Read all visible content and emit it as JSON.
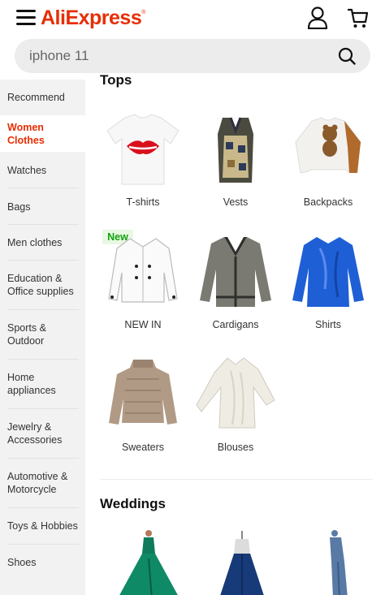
{
  "header": {
    "logo": "AliExpress",
    "logo_mark": "®",
    "icons": [
      "menu-icon",
      "user-icon",
      "cart-icon"
    ]
  },
  "search": {
    "value": "iphone 11",
    "icon": "search-icon"
  },
  "sidebar": {
    "items": [
      {
        "label": "Recommend",
        "active": false
      },
      {
        "label": "Women Clothes",
        "active": true
      },
      {
        "label": "Watches",
        "active": false
      },
      {
        "label": "Bags",
        "active": false
      },
      {
        "label": "Men clothes",
        "active": false
      },
      {
        "label": "Education & Office supplies",
        "active": false
      },
      {
        "label": "Sports & Outdoor",
        "active": false
      },
      {
        "label": "Home appliances",
        "active": false
      },
      {
        "label": "Jewelry & Accessories",
        "active": false
      },
      {
        "label": "Automotive & Motorcycle",
        "active": false
      },
      {
        "label": "Toys & Hobbies",
        "active": false
      },
      {
        "label": "Shoes",
        "active": false
      }
    ]
  },
  "main": {
    "sections": [
      {
        "title": "Tops",
        "items": [
          {
            "label": "T-shirts"
          },
          {
            "label": "Vests"
          },
          {
            "label": "Backpacks"
          },
          {
            "label": "NEW IN",
            "badge": "New"
          },
          {
            "label": "Cardigans"
          },
          {
            "label": "Shirts"
          },
          {
            "label": "Sweaters"
          },
          {
            "label": "Blouses"
          }
        ]
      },
      {
        "title": "Weddings",
        "items": []
      }
    ]
  },
  "colors": {
    "brand": "#e62e04",
    "badge_green": "#13a10e",
    "sidebar_bg": "#f2f2f2"
  }
}
